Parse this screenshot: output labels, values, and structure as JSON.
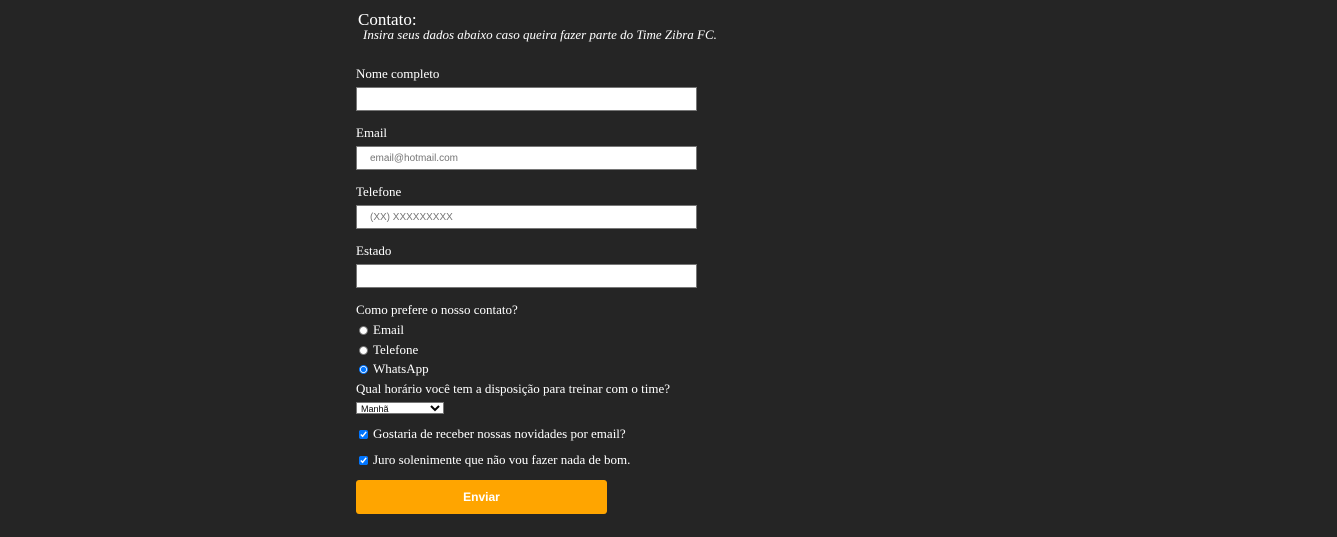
{
  "header": {
    "title": "Contato:",
    "subtitle": "Insira seus dados abaixo caso queira fazer parte do Time Zibra FC."
  },
  "form": {
    "name": {
      "label": "Nome completo",
      "value": "",
      "placeholder": ""
    },
    "email": {
      "label": "Email",
      "value": "",
      "placeholder": "email@hotmail.com"
    },
    "phone": {
      "label": "Telefone",
      "value": "",
      "placeholder": "(XX) XXXXXXXXX"
    },
    "state": {
      "label": "Estado",
      "value": "",
      "placeholder": ""
    },
    "contact_pref": {
      "label": "Como prefere o nosso contato?",
      "options": [
        "Email",
        "Telefone",
        "WhatsApp"
      ],
      "selected": "WhatsApp"
    },
    "schedule": {
      "label": "Qual horário você tem a disposição para treinar com o time?",
      "selected": "Manhã"
    },
    "newsletter": {
      "label": "Gostaria de receber nossas novidades por email?",
      "checked": true
    },
    "oath": {
      "label": "Juro solenimente que não vou fazer nada de bom.",
      "checked": true
    },
    "submit_label": "Enviar"
  },
  "colors": {
    "background": "#252525",
    "accent": "#ffa500"
  }
}
